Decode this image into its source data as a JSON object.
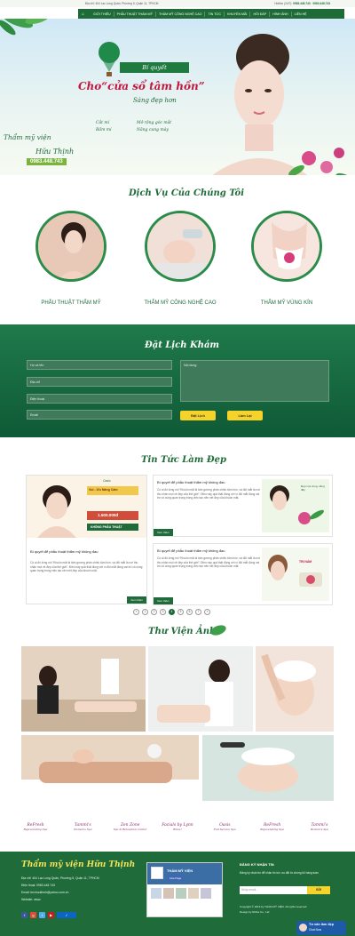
{
  "topbar": {
    "address": "Địa chỉ: 404 Lạc Long Quân, Phường 5, Quận 11, TPHCM",
    "hotline_label": "Hotline (24/7):",
    "hotline_1": "0983.448.743",
    "hotline_2": "0983.448.743"
  },
  "nav": {
    "home_icon": "home-icon",
    "items": [
      "GIỚI THIỆU",
      "PHẪU THUẬT THẨM MỸ",
      "THẨM MỸ CÔNG NGHỆ CAO",
      "TIN TỨC",
      "KHUYẾN MÃI",
      "HỎI ĐÁP",
      "HÌNH ẢNH",
      "LIÊN HỆ"
    ]
  },
  "hero": {
    "ribbon": "Bí quyết",
    "title": "Cho“cửa sổ tâm hồn”",
    "subtitle": "Sáng đẹp hơn",
    "bullets": [
      "Cắt mí",
      "Mở rộng góc mắt",
      "Bấm mí",
      "Nâng cung mày"
    ],
    "brand_line1": "Thẩm mỹ viện",
    "brand_line2": "Hữu Thịnh",
    "phone": "0983.448.743"
  },
  "services": {
    "title": "Dịch Vụ Của Chúng Tôi",
    "items": [
      {
        "label": "PHẪU THUẬT THẨM MỸ"
      },
      {
        "label": "THẨM MỸ CÔNG NGHỆ CAO"
      },
      {
        "label": "THẨM MỸ VÙNG KÍN"
      }
    ]
  },
  "booking": {
    "title": "Đặt Lịch Khám",
    "fields": [
      "Họ và tên",
      "Địa chỉ",
      "Điện thoại",
      "Email"
    ],
    "content_placeholder": "Nội dung",
    "submit": "Đặt Lịch",
    "reset": "Làm Lại"
  },
  "news": {
    "title": "Tin Tức Làm Đẹp",
    "featured_title": "Bí quyết để phẫu thuật thẩm mỹ không đau",
    "featured_text": "Có ai đó từng nói “Khuôn mặt là tấm gương phản chiếu tâm hồn, và đôi mắt là nơi thu nhận mọi vẻ đẹp của thế giới”. Điều này quả thật đúng với vì đôi mắt đóng vai trò vô cùng quan trọng trong việc tạo nên nét đẹp của khuôn mặt.",
    "promo_brand": "Oasis",
    "promo_line": "Vui - Ưu Nàng Cảm",
    "promo_price": "1.500.000đ",
    "promo_note": "KHÔNG PHẪU THUẬT",
    "side_posts": [
      {
        "title": "Bí quyết để phẫu thuật thẩm mỹ không đau",
        "text": "Có ai đó từng nói “Khuôn mặt là tấm gương phản chiếu tâm hồn, và đôi mắt là nơi thu nhận mọi vẻ đẹp của thế giới”. Điều này quả thật đúng với vì đôi mắt đóng vai trò vô cùng quan trọng trong việc tạo nên nét đẹp của khuôn mặt.",
        "image_caption": "Đẹp mọi vùng, căng đầy"
      },
      {
        "title": "Bí quyết để phẫu thuật thẩm mỹ không đau",
        "text": "Có ai đó từng nói “Khuôn mặt là tấm gương phản chiếu tâm hồn, và đôi mắt là nơi thu nhận mọi vẻ đẹp của thế giới”. Điều này quả thật đúng với vì đôi mắt đóng vai trò vô cùng quan trọng trong việc tạo nên nét đẹp của khuôn mặt.",
        "image_caption": "TRỊ NÁM"
      }
    ],
    "more": "Xem thêm",
    "pages": [
      "«",
      "1",
      "2",
      "3",
      "4",
      "5",
      "6",
      "7",
      "»"
    ],
    "current_page": "4"
  },
  "gallery": {
    "title": "Thư Viện Ảnh"
  },
  "partners": [
    {
      "name": "ReFresh",
      "sub": "Rejuvenating Spa"
    },
    {
      "name": "Tammi's",
      "sub": "Women's Spa"
    },
    {
      "name": "Zen Zone",
      "sub": "Spa & Relaxation Center"
    },
    {
      "name": "Facials by Lynn",
      "sub": "Relax!"
    },
    {
      "name": "Oasis",
      "sub": "Full Service Spa"
    },
    {
      "name": "ReFresh",
      "sub": "Rejuvenating Spa"
    },
    {
      "name": "Tammi's",
      "sub": "Women's Spa"
    }
  ],
  "footer": {
    "brand": "Thẩm mỹ viện Hữu Thịnh",
    "address": "Địa chỉ: 404 Lạc Long Quân, Phường 5, Quận 11, TPHCM",
    "hotline": "Điện thoại: 0983.448.743",
    "email": "Email: tmvhuuthinh@yahoo.com.vn",
    "website": "Website: www.",
    "fb_title": "THẨM MỸ VIỆN",
    "fb_like": "Like Page",
    "subscribe_title": "ĐĂNG KÝ NHẬN TIN",
    "subscribe_note": "Đăng ký nhận tin để nhận tin tức ưu đãi từ chúng tôi hàng tuần",
    "subscribe_placeholder": "Nhập email...",
    "subscribe_btn": "GỬI",
    "copyright": "Copyright © 2016 by THẨM MỸ VIỆN. All rights reserved.",
    "design": "Design by Nhiha Co., Ltd",
    "chat_title": "Tư vấn làm đẹp",
    "chat_sub": "Chat Now"
  },
  "colors": {
    "brand_green": "#1f6b3a",
    "accent_pink": "#c4163f",
    "button_yellow": "#f5d32b"
  }
}
